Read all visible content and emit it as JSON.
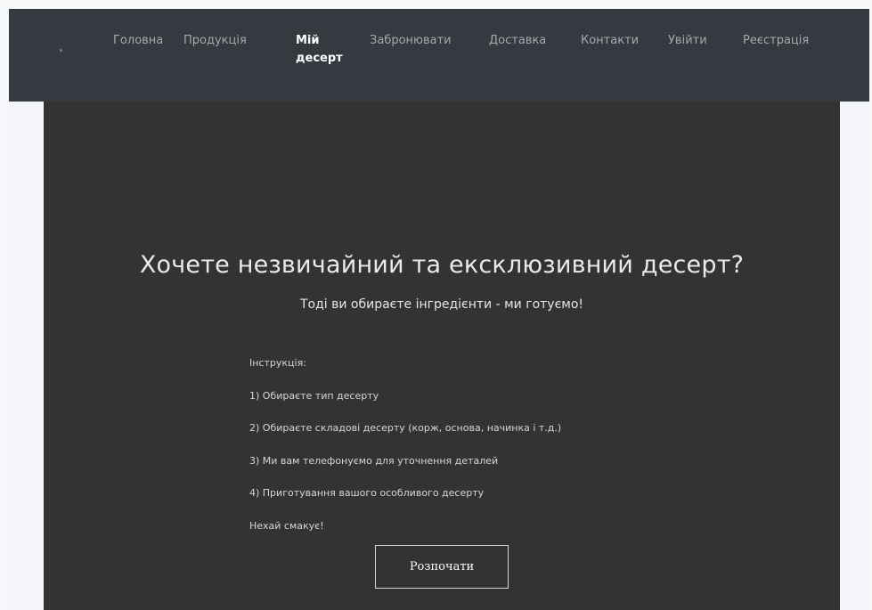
{
  "nav": {
    "items": [
      {
        "label": "Головна",
        "active": false
      },
      {
        "label": "Продукція",
        "active": false
      },
      {
        "label": "Мій десерт",
        "active": true
      },
      {
        "label": "Забронювати",
        "active": false
      },
      {
        "label": "Доставка",
        "active": false
      },
      {
        "label": "Контакти",
        "active": false
      },
      {
        "label": "Увійти",
        "active": false
      },
      {
        "label": "Реєстрація",
        "active": false
      }
    ]
  },
  "hero": {
    "title": "Хочете незвичайний та ексклюзивний десерт?",
    "subtitle": "Тоді ви обираєте інгредієнти - ми готуємо!",
    "instructions": [
      "Інструкція:",
      "1) Обираєте тип десерту",
      "2) Обираєте складові десерту (корж, основа, начинка і т.д.)",
      "3) Ми вам телефонуємо для уточнення деталей",
      "4) Приготування вашого особливого десерту",
      "Нехай смакує!"
    ],
    "button_label": "Розпочати"
  },
  "colors": {
    "navbar_bg": "#343a40",
    "hero_bg": "#333333",
    "page_bg": "#f4f6f9",
    "nav_text": "#a5a9ae",
    "nav_active": "#ffffff"
  }
}
